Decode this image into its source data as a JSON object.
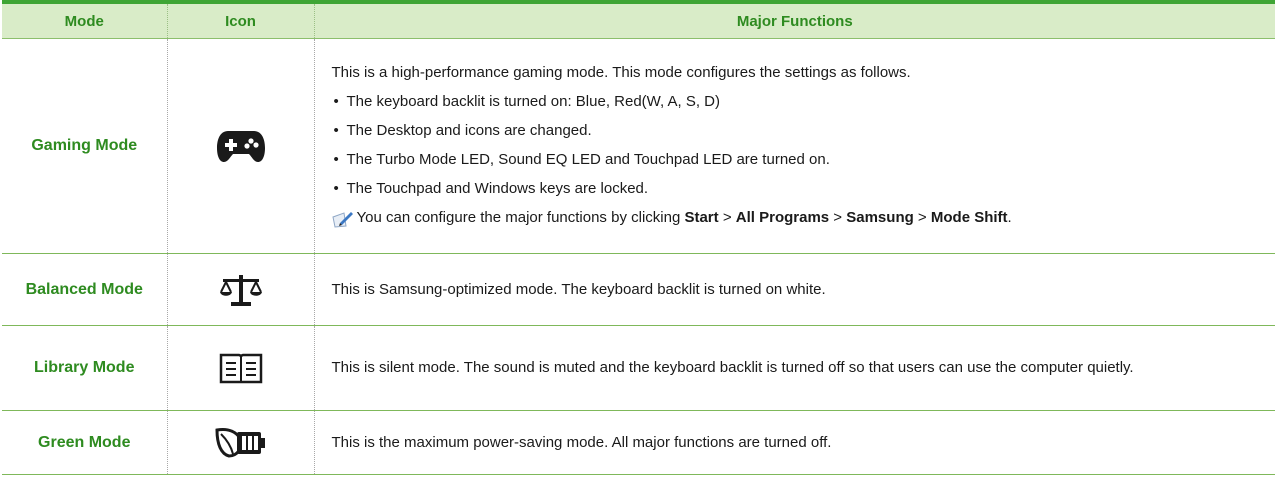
{
  "header": {
    "mode": "Mode",
    "icon": "Icon",
    "functions": "Major Functions"
  },
  "colors": {
    "accent_green": "#3fa535",
    "header_bg": "#d9ecc8",
    "mode_text": "#2e8b20"
  },
  "rows": [
    {
      "mode": "Gaming Mode",
      "icon": "gamepad-icon",
      "intro": "This is a high-performance gaming mode. This mode configures the settings as follows.",
      "bullets": [
        "The keyboard backlit is turned on: Blue, Red(W, A, S, D)",
        "The Desktop and icons are changed.",
        "The Turbo Mode LED, Sound EQ LED and Touchpad LED are turned on.",
        "The Touchpad and Windows keys are locked."
      ],
      "note": {
        "icon": "note-pencil-icon",
        "prefix": "You can configure the major functions by clicking ",
        "p1": "Start",
        "sep1": " > ",
        "p2": "All Programs",
        "sep2": " > ",
        "p3": "Samsung",
        "sep3": " > ",
        "p4": "Mode Shift",
        "suffix": "."
      }
    },
    {
      "mode": "Balanced Mode",
      "icon": "scale-icon",
      "description": "This is Samsung-optimized mode. The keyboard backlit is turned on white."
    },
    {
      "mode": "Library Mode",
      "icon": "book-icon",
      "description": "This is silent mode. The sound is muted and the keyboard backlit is turned off so that users can use the computer quietly."
    },
    {
      "mode": "Green Mode",
      "icon": "leaf-battery-icon",
      "description": "This is the maximum power-saving mode. All major functions are turned off."
    }
  ]
}
